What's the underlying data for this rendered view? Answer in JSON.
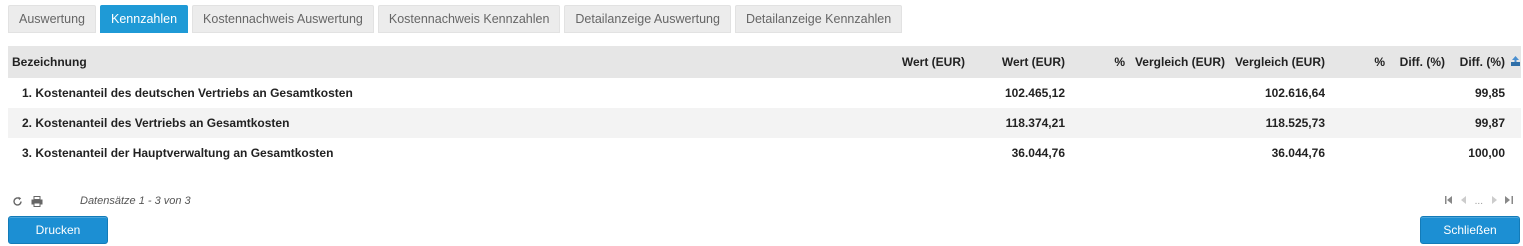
{
  "tabs": [
    {
      "label": "Auswertung",
      "active": false
    },
    {
      "label": "Kennzahlen",
      "active": true
    },
    {
      "label": "Kostennachweis Auswertung",
      "active": false
    },
    {
      "label": "Kostennachweis Kennzahlen",
      "active": false
    },
    {
      "label": "Detailanzeige Auswertung",
      "active": false
    },
    {
      "label": "Detailanzeige Kennzahlen",
      "active": false
    }
  ],
  "table": {
    "columns": [
      "Bezeichnung",
      "Wert (EUR)",
      "Wert (EUR)",
      "%",
      "Vergleich (EUR)",
      "Vergleich (EUR)",
      "%",
      "Diff. (%)",
      "Diff. (%)"
    ],
    "rows": [
      [
        "1. Kostenanteil des deutschen Vertriebs an Gesamtkosten",
        "",
        "102.465,12",
        "",
        "",
        "102.616,64",
        "",
        "",
        "99,85"
      ],
      [
        "2. Kostenanteil des Vertriebs an Gesamtkosten",
        "",
        "118.374,21",
        "",
        "",
        "118.525,73",
        "",
        "",
        "99,87"
      ],
      [
        "3. Kostenanteil der Hauptverwaltung an Gesamtkosten",
        "",
        "36.044,76",
        "",
        "",
        "36.044,76",
        "",
        "",
        "100,00"
      ]
    ]
  },
  "pager": {
    "records_label": "Datensätze 1 - 3 von 3",
    "ellipsis": "..."
  },
  "buttons": {
    "print_label": "Drucken",
    "close_label": "Schließen"
  },
  "colors": {
    "accent": "#1f9ad6",
    "header_bg": "#e6e6e6"
  },
  "icons": [
    "refresh-icon",
    "print-icon",
    "export-icon",
    "first-page-icon",
    "prev-page-icon",
    "next-page-icon",
    "last-page-icon"
  ]
}
